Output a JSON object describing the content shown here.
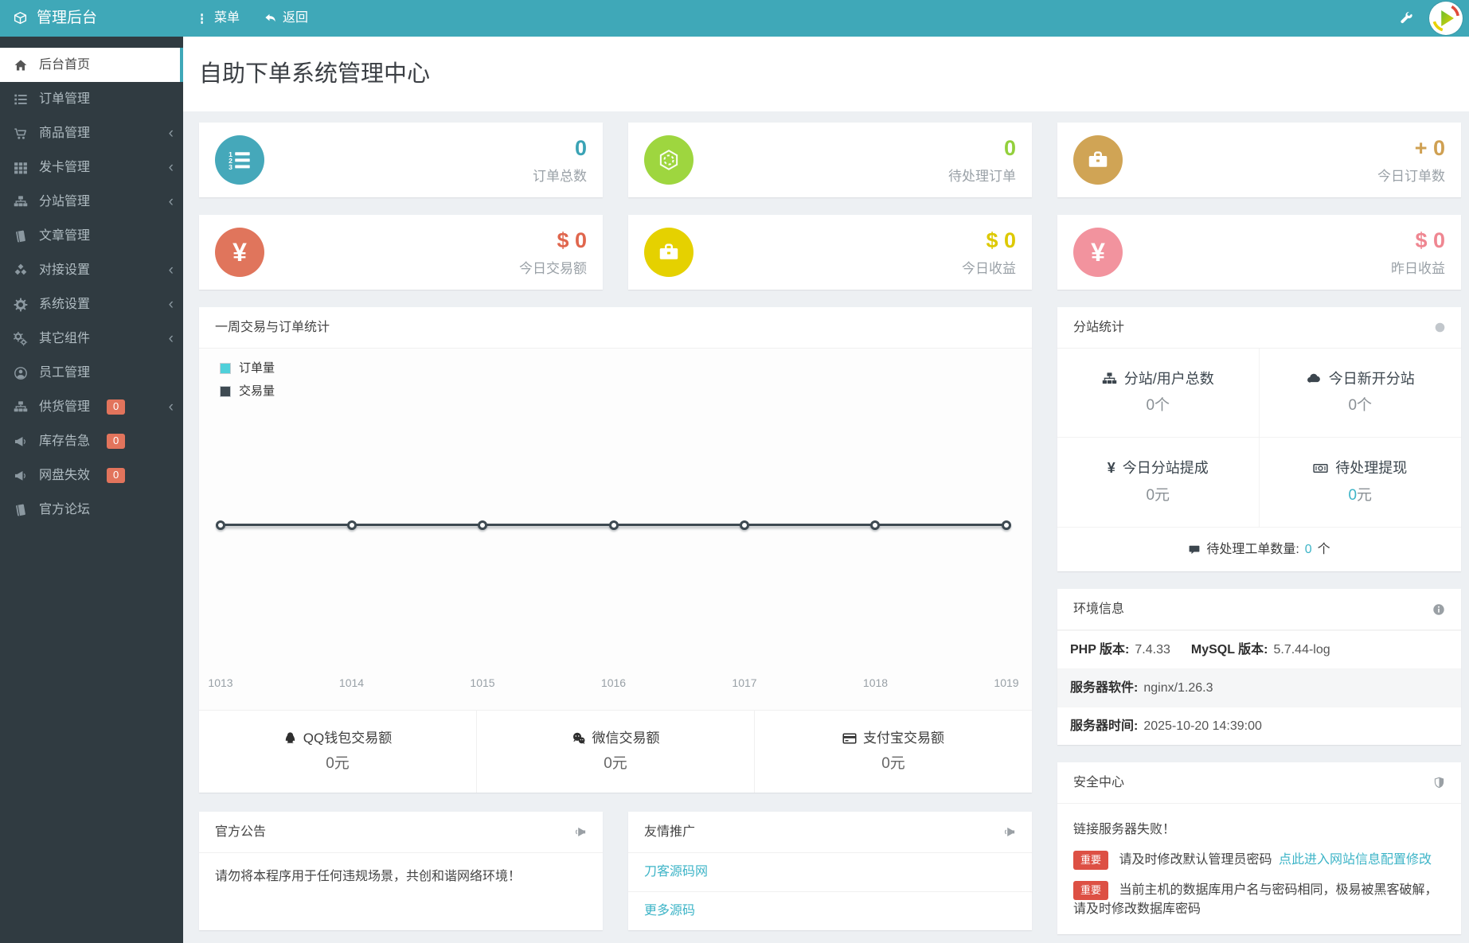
{
  "colors": {
    "topbar_teal": "#3fa8b8",
    "sidebar_dark": "#303b41",
    "link_cyan": "#3db4c7",
    "sidebar_badge_orange": "#e2745c",
    "danger_badge_red": "#dd5044",
    "legend_orders_cyan": "#4fd0da",
    "legend_trades_dark": "#3e4a52"
  },
  "icons": {
    "yen": "¥",
    "chevron_left": "‹"
  },
  "topbar": {
    "brand": "管理后台",
    "menu_label": "菜单",
    "back_label": "返回"
  },
  "page": {
    "title": "自助下单系统管理中心"
  },
  "sidebar": {
    "items": [
      {
        "label": "后台首页"
      },
      {
        "label": "订单管理"
      },
      {
        "label": "商品管理"
      },
      {
        "label": "发卡管理"
      },
      {
        "label": "分站管理"
      },
      {
        "label": "文章管理"
      },
      {
        "label": "对接设置"
      },
      {
        "label": "系统设置"
      },
      {
        "label": "其它组件"
      },
      {
        "label": "员工管理"
      },
      {
        "label": "供货管理",
        "badge": "0"
      },
      {
        "label": "库存告急",
        "badge": "0"
      },
      {
        "label": "网盘失效",
        "badge": "0"
      },
      {
        "label": "官方论坛"
      }
    ]
  },
  "stats": [
    {
      "value": "0",
      "label": "订单总数"
    },
    {
      "value": "0",
      "label": "待处理订单"
    },
    {
      "value": "+ 0",
      "label": "今日订单数"
    },
    {
      "value": "$ 0",
      "label": "今日交易额"
    },
    {
      "value": "$ 0",
      "label": "今日收益"
    },
    {
      "value": "$ 0",
      "label": "昨日收益"
    }
  ],
  "chart_data": {
    "type": "line",
    "title": "一周交易与订单统计",
    "categories": [
      "1013",
      "1014",
      "1015",
      "1016",
      "1017",
      "1018",
      "1019"
    ],
    "series": [
      {
        "name": "订单量",
        "values": [
          0,
          0,
          0,
          0,
          0,
          0,
          0
        ]
      },
      {
        "name": "交易量",
        "values": [
          0,
          0,
          0,
          0,
          0,
          0,
          0
        ]
      }
    ],
    "ylim": [
      0,
      1
    ],
    "grid": false,
    "legend_position": "top-left"
  },
  "pay_stats": [
    {
      "label": "QQ钱包交易额",
      "value": "0元"
    },
    {
      "label": "微信交易额",
      "value": "0元"
    },
    {
      "label": "支付宝交易额",
      "value": "0元"
    }
  ],
  "substation": {
    "title": "分站统计",
    "cells": [
      {
        "label": "分站/用户总数",
        "value": "0个"
      },
      {
        "label": "今日新开分站",
        "value": "0个"
      },
      {
        "label": "今日分站提成",
        "value": "0元"
      },
      {
        "label": "待处理提现",
        "value_num": "0",
        "value_unit": "元"
      }
    ],
    "footer_label": "待处理工单数量:",
    "footer_value": "0",
    "footer_unit": "个"
  },
  "env": {
    "title": "环境信息",
    "php_label": "PHP 版本:",
    "php_value": "7.4.33",
    "mysql_label": "MySQL 版本:",
    "mysql_value": "5.7.44-log",
    "server_label": "服务器软件:",
    "server_value": "nginx/1.26.3",
    "time_label": "服务器时间:",
    "time_value": "2025-10-20 14:39:00"
  },
  "security": {
    "title": "安全中心",
    "line1": "链接服务器失败！",
    "badge": "重要",
    "line2_text": "请及时修改默认管理员密码",
    "line2_link": "点此进入网站信息配置修改",
    "line3_text": "当前主机的数据库用户名与密码相同，极易被黑客破解，请及时修改数据库密码"
  },
  "announce": {
    "title": "官方公告",
    "content": "请勿将本程序用于任何违规场景，共创和谐网络环境！"
  },
  "promo": {
    "title": "友情推广",
    "links": [
      "刀客源码网",
      "更多源码"
    ]
  }
}
